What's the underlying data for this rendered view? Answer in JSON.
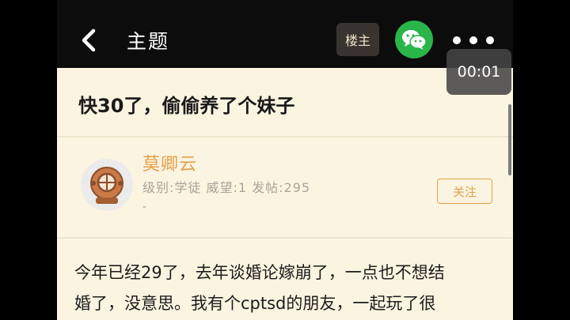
{
  "header": {
    "title": "主题",
    "owner_label": "楼主"
  },
  "timer": "00:01",
  "post": {
    "title": "快30了，偷偷养了个妹子",
    "author": {
      "name": "莫卿云",
      "meta": "级别:学徒 威望:1 发帖:295",
      "extra": "-",
      "follow_label": "关注"
    },
    "body_lines": [
      "今年已经29了，去年谈婚论嫁崩了，一点也不想结",
      "婚了，没意思。我有个cptsd的朋友，一起玩了很"
    ]
  },
  "colors": {
    "topbar": "#0c0c0c",
    "background": "#fbf4e1",
    "accent": "#e3a04c",
    "wechat": "#2ab54a"
  },
  "icons": {
    "back": "back-arrow-icon",
    "share": "wechat-icon",
    "more": "more-icon",
    "avatar": "diving-helmet-avatar"
  }
}
